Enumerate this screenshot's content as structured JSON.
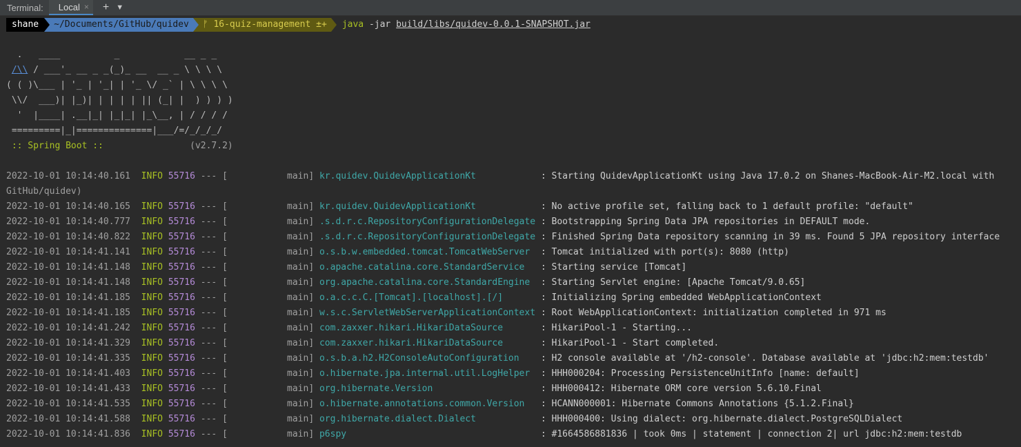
{
  "tabbar": {
    "title": "Terminal:",
    "tab_label": "Local",
    "close_glyph": "×",
    "add_glyph": "+",
    "more_glyph": "⌄"
  },
  "prompt": {
    "user": "shane",
    "path": "~/Documents/GitHub/quidev",
    "branch": "ᚠ 16-quiz-management ±+",
    "cmd_java": "java",
    "cmd_flag": " -jar ",
    "cmd_jar": "build/libs/quidev-0.0.1-SNAPSHOT.jar"
  },
  "banner": {
    "l1": "  .   ____          _            __ _ _",
    "l2a": " ",
    "l2link": "/\\\\",
    "l2b": " / ___'_ __ _ _(_)_ __  __ _ \\ \\ \\ \\",
    "l3": "( ( )\\___ | '_ | '_| | '_ \\/ _` | \\ \\ \\ \\",
    "l4": " \\\\/  ___)| |_)| | | | | || (_| |  ) ) ) )",
    "l5": "  '  |____| .__|_| |_|_| |_\\__, | / / / /",
    "l6": " =========|_|==============|___/=/_/_/_/",
    "spring": " :: Spring Boot ::",
    "version": "                (v2.7.2)"
  },
  "logs": [
    {
      "ts": "2022-10-01 10:14:40.161",
      "lvl": "INFO",
      "pid": "55716",
      "sep": " --- [           main] ",
      "cls": "kr.quidev.QuidevApplicationKt           ",
      "msg": " : Starting QuidevApplicationKt using Java 17.0.2 on Shanes-MacBook-Air-M2.local with"
    },
    {
      "ts": "GitHub/quidev)",
      "lvl": "",
      "pid": "",
      "sep": "",
      "cls": "",
      "msg": ""
    },
    {
      "ts": "2022-10-01 10:14:40.165",
      "lvl": "INFO",
      "pid": "55716",
      "sep": " --- [           main] ",
      "cls": "kr.quidev.QuidevApplicationKt           ",
      "msg": " : No active profile set, falling back to 1 default profile: \"default\""
    },
    {
      "ts": "2022-10-01 10:14:40.777",
      "lvl": "INFO",
      "pid": "55716",
      "sep": " --- [           main] ",
      "cls": ".s.d.r.c.RepositoryConfigurationDelegate",
      "msg": " : Bootstrapping Spring Data JPA repositories in DEFAULT mode."
    },
    {
      "ts": "2022-10-01 10:14:40.822",
      "lvl": "INFO",
      "pid": "55716",
      "sep": " --- [           main] ",
      "cls": ".s.d.r.c.RepositoryConfigurationDelegate",
      "msg": " : Finished Spring Data repository scanning in 39 ms. Found 5 JPA repository interface"
    },
    {
      "ts": "2022-10-01 10:14:41.141",
      "lvl": "INFO",
      "pid": "55716",
      "sep": " --- [           main] ",
      "cls": "o.s.b.w.embedded.tomcat.TomcatWebServer ",
      "msg": " : Tomcat initialized with port(s): 8080 (http)"
    },
    {
      "ts": "2022-10-01 10:14:41.148",
      "lvl": "INFO",
      "pid": "55716",
      "sep": " --- [           main] ",
      "cls": "o.apache.catalina.core.StandardService  ",
      "msg": " : Starting service [Tomcat]"
    },
    {
      "ts": "2022-10-01 10:14:41.148",
      "lvl": "INFO",
      "pid": "55716",
      "sep": " --- [           main] ",
      "cls": "org.apache.catalina.core.StandardEngine ",
      "msg": " : Starting Servlet engine: [Apache Tomcat/9.0.65]"
    },
    {
      "ts": "2022-10-01 10:14:41.185",
      "lvl": "INFO",
      "pid": "55716",
      "sep": " --- [           main] ",
      "cls": "o.a.c.c.C.[Tomcat].[localhost].[/]      ",
      "msg": " : Initializing Spring embedded WebApplicationContext"
    },
    {
      "ts": "2022-10-01 10:14:41.185",
      "lvl": "INFO",
      "pid": "55716",
      "sep": " --- [           main] ",
      "cls": "w.s.c.ServletWebServerApplicationContext",
      "msg": " : Root WebApplicationContext: initialization completed in 971 ms"
    },
    {
      "ts": "2022-10-01 10:14:41.242",
      "lvl": "INFO",
      "pid": "55716",
      "sep": " --- [           main] ",
      "cls": "com.zaxxer.hikari.HikariDataSource      ",
      "msg": " : HikariPool-1 - Starting..."
    },
    {
      "ts": "2022-10-01 10:14:41.329",
      "lvl": "INFO",
      "pid": "55716",
      "sep": " --- [           main] ",
      "cls": "com.zaxxer.hikari.HikariDataSource      ",
      "msg": " : HikariPool-1 - Start completed."
    },
    {
      "ts": "2022-10-01 10:14:41.335",
      "lvl": "INFO",
      "pid": "55716",
      "sep": " --- [           main] ",
      "cls": "o.s.b.a.h2.H2ConsoleAutoConfiguration   ",
      "msg": " : H2 console available at '/h2-console'. Database available at 'jdbc:h2:mem:testdb'"
    },
    {
      "ts": "2022-10-01 10:14:41.403",
      "lvl": "INFO",
      "pid": "55716",
      "sep": " --- [           main] ",
      "cls": "o.hibernate.jpa.internal.util.LogHelper ",
      "msg": " : HHH000204: Processing PersistenceUnitInfo [name: default]"
    },
    {
      "ts": "2022-10-01 10:14:41.433",
      "lvl": "INFO",
      "pid": "55716",
      "sep": " --- [           main] ",
      "cls": "org.hibernate.Version                   ",
      "msg": " : HHH000412: Hibernate ORM core version 5.6.10.Final"
    },
    {
      "ts": "2022-10-01 10:14:41.535",
      "lvl": "INFO",
      "pid": "55716",
      "sep": " --- [           main] ",
      "cls": "o.hibernate.annotations.common.Version  ",
      "msg": " : HCANN000001: Hibernate Commons Annotations {5.1.2.Final}"
    },
    {
      "ts": "2022-10-01 10:14:41.588",
      "lvl": "INFO",
      "pid": "55716",
      "sep": " --- [           main] ",
      "cls": "org.hibernate.dialect.Dialect           ",
      "msg": " : HHH000400: Using dialect: org.hibernate.dialect.PostgreSQLDialect"
    },
    {
      "ts": "2022-10-01 10:14:41.836",
      "lvl": "INFO",
      "pid": "55716",
      "sep": " --- [           main] ",
      "cls": "p6spy                                   ",
      "msg": " : #1664586881836 | took 0ms | statement | connection 2| url jdbc:h2:mem:testdb"
    }
  ]
}
